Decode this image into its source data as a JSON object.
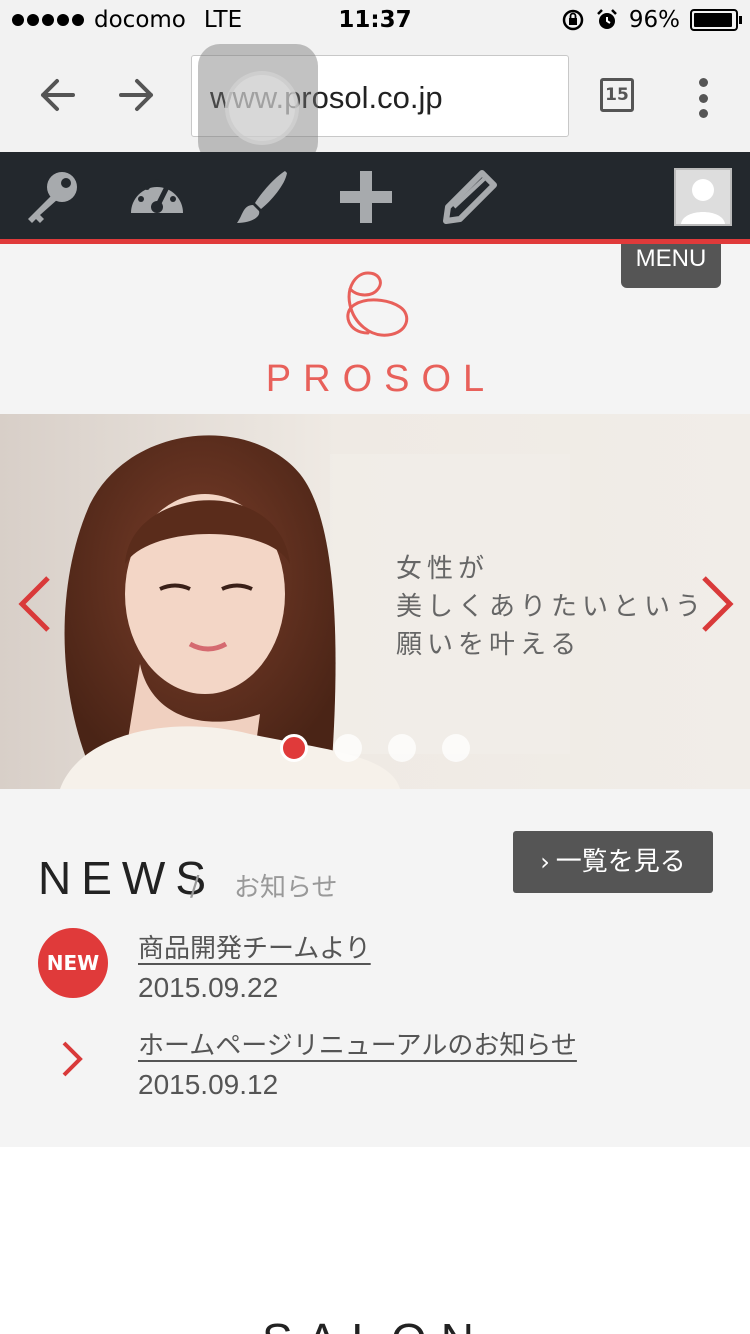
{
  "status": {
    "carrier": "docomo",
    "network": "LTE",
    "time": "11:37",
    "battery": "96%"
  },
  "browser": {
    "url": "www.prosol.co.jp",
    "tab_count": "15",
    "icons": [
      "back-arrow-icon",
      "forward-arrow-icon",
      "tabs-icon",
      "overflow-menu-icon"
    ]
  },
  "admin_bar": {
    "icons": [
      "key-icon",
      "dashboard-icon",
      "brush-icon",
      "plus-icon",
      "pencil-icon",
      "avatar"
    ]
  },
  "menu_label": "MENU",
  "logo": {
    "text": "PROSOL",
    "color": "#e8605a"
  },
  "hero": {
    "lines": [
      "女性が",
      "美しくありたいという",
      "願いを叶える"
    ],
    "slide_count": 4,
    "active_slide": 1
  },
  "news": {
    "title": "NEWS",
    "slash": "/",
    "subtitle": "お知らせ",
    "list_button": "一覧を見る",
    "items": [
      {
        "badge": "NEW",
        "title": "商品開発チームより",
        "date": "2015.09.22"
      },
      {
        "badge": "",
        "title": "ホームページリニューアルのお知らせ",
        "date": "2015.09.12"
      }
    ]
  },
  "salon_heading": "SALON",
  "colors": {
    "accent": "#e03a3a",
    "admin_bar": "#23282d",
    "button": "#555555"
  }
}
